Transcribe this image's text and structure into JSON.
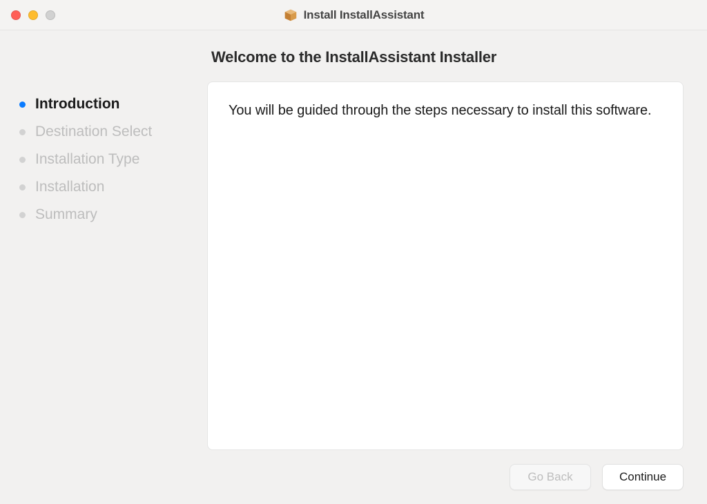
{
  "window": {
    "title": "Install InstallAssistant"
  },
  "sidebar": {
    "steps": [
      {
        "label": "Introduction",
        "active": true
      },
      {
        "label": "Destination Select",
        "active": false
      },
      {
        "label": "Installation Type",
        "active": false
      },
      {
        "label": "Installation",
        "active": false
      },
      {
        "label": "Summary",
        "active": false
      }
    ]
  },
  "main": {
    "heading": "Welcome to the InstallAssistant Installer",
    "body_text": "You will be guided through the steps necessary to install this software."
  },
  "buttons": {
    "go_back": "Go Back",
    "continue": "Continue"
  }
}
